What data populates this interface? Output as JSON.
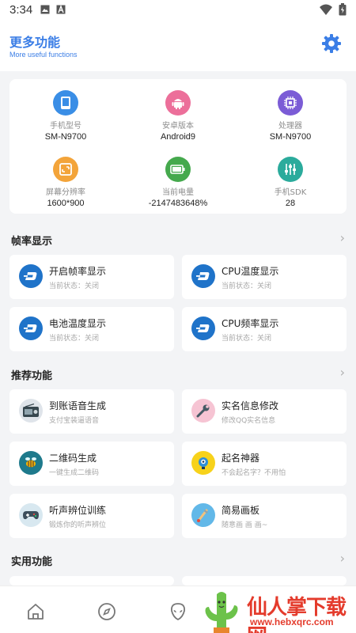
{
  "status_bar": {
    "time": "3:34"
  },
  "header": {
    "title": "更多功能",
    "subtitle": "More useful functions",
    "settings_icon": "gear-icon"
  },
  "device_info": [
    {
      "label": "手机型号",
      "value": "SM-N9700",
      "icon": "phone-icon",
      "color": "#3a8ee6"
    },
    {
      "label": "安卓版本",
      "value": "Android9",
      "icon": "android-icon",
      "color": "#ec6f9a"
    },
    {
      "label": "处理器",
      "value": "SM-N9700",
      "icon": "chip-icon",
      "color": "#7b5cd6"
    },
    {
      "label": "屏幕分辨率",
      "value": "1600*900",
      "icon": "screen-icon",
      "color": "#f3a43a"
    },
    {
      "label": "当前电量",
      "value": "-2147483648%",
      "icon": "battery-icon",
      "color": "#45a94d"
    },
    {
      "label": "手机SDK",
      "value": "28",
      "icon": "sliders-icon",
      "color": "#2bab9c"
    }
  ],
  "sections": {
    "framerate": {
      "title": "帧率显示",
      "items": [
        {
          "name": "开启帧率显示",
          "desc": "当前状态：关闭"
        },
        {
          "name": "CPU温度显示",
          "desc": "当前状态：关闭"
        },
        {
          "name": "电池温度显示",
          "desc": "当前状态：关闭"
        },
        {
          "name": "CPU频率显示",
          "desc": "当前状态：关闭"
        }
      ]
    },
    "recommended": {
      "title": "推荐功能",
      "items": [
        {
          "name": "到账语音生成",
          "desc": "支付宝装逼语音",
          "icon": "radio-icon"
        },
        {
          "name": "实名信息修改",
          "desc": "修改QQ实名信息",
          "icon": "wrench-icon"
        },
        {
          "name": "二维码生成",
          "desc": "一键生成二维码",
          "icon": "bee-icon"
        },
        {
          "name": "起名神器",
          "desc": "不会起名字？不用怕",
          "icon": "bulb-head-icon"
        },
        {
          "name": "听声辨位训练",
          "desc": "锻炼你的听声辨位",
          "icon": "gamepad-icon"
        },
        {
          "name": "简易画板",
          "desc": "随意画 画 画~",
          "icon": "paint-brush-icon"
        }
      ]
    },
    "utility": {
      "title": "实用功能"
    }
  },
  "bottom_nav": [
    "home-icon",
    "compass-icon",
    "alien-icon"
  ],
  "watermark": {
    "text": "仙人掌下载网",
    "url": "www.hebxqrc.com"
  },
  "colors": {
    "accent": "#3b7ee6",
    "dash_blue": "#1f73c9",
    "background": "#f3f4f6"
  }
}
